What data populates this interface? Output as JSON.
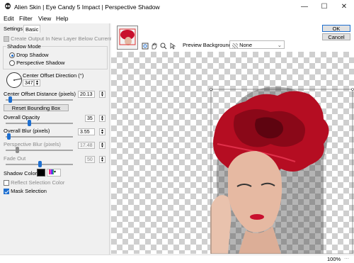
{
  "window": {
    "title": "Alien Skin | Eye Candy 5 Impact | Perspective Shadow"
  },
  "menu": [
    "Edit",
    "Filter",
    "View",
    "Help"
  ],
  "tabs": [
    "Settings",
    "Basic"
  ],
  "basic": {
    "create_output_label": "Create Output In New Layer Below Current",
    "shadow_mode_label": "Shadow Mode",
    "drop_shadow_label": "Drop Shadow",
    "perspective_shadow_label": "Perspective Shadow",
    "selected_mode": "Drop Shadow",
    "center_offset_direction_label": "Center Offset Direction (°)",
    "center_offset_direction_value": "347",
    "center_offset_distance_label": "Center Offset Distance (pixels)",
    "center_offset_distance_value": "20.13",
    "center_offset_distance_fraction": 0.06,
    "reset_bounding_box_label": "Reset Bounding Box",
    "overall_opacity_label": "Overall Opacity",
    "overall_opacity_value": "35",
    "overall_opacity_fraction": 0.35,
    "overall_blur_label": "Overall Blur (pixels)",
    "overall_blur_value": "3.55",
    "overall_blur_fraction": 0.04,
    "perspective_blur_label": "Perspective Blur (pixels)",
    "perspective_blur_value": "17.48",
    "perspective_blur_fraction": 0.17,
    "fade_out_label": "Fade Out",
    "fade_out_value": "50",
    "fade_out_fraction": 0.5,
    "shadow_color_label": "Shadow Color",
    "shadow_color": "#000000",
    "reflect_selection_color_label": "Reflect Selection Color",
    "mask_selection_label": "Mask Selection"
  },
  "preview": {
    "background_label": "Preview Background:",
    "background_value": "None"
  },
  "buttons": {
    "ok": "OK",
    "cancel": "Cancel"
  },
  "status": {
    "zoom": "100%"
  },
  "colors": {
    "accent": "#1e6fd0",
    "rose": "#c8102e"
  }
}
